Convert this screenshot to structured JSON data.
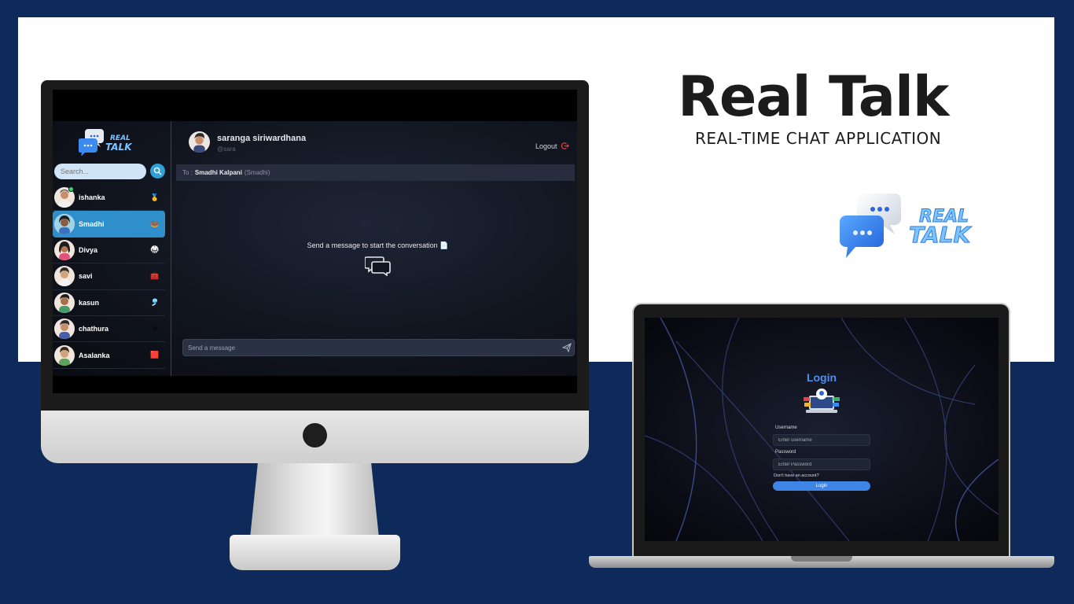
{
  "hero": {
    "title": "Real Talk",
    "subtitle": "REAL-TIME CHAT APPLICATION",
    "logo_text_line1": "REAL",
    "logo_text_line2": "TALK"
  },
  "desktop_app": {
    "sidebar": {
      "logo_line1": "REAL",
      "logo_line2": "TALK",
      "search_placeholder": "Search...",
      "contacts": [
        {
          "name": "ishanka",
          "emoji": "🥇",
          "online": true,
          "active": false
        },
        {
          "name": "Smadhi",
          "emoji": "🍩",
          "online": false,
          "active": true
        },
        {
          "name": "Divya",
          "emoji": "🥋",
          "online": false,
          "active": false
        },
        {
          "name": "savi",
          "emoji": "🧰",
          "online": false,
          "active": false
        },
        {
          "name": "kasun",
          "emoji": "🎐",
          "online": false,
          "active": false
        },
        {
          "name": "chathura",
          "emoji": "⚪",
          "online": false,
          "active": false
        },
        {
          "name": "Asalanka",
          "emoji": "🟥",
          "online": false,
          "active": false
        }
      ]
    },
    "header": {
      "user_name": "saranga siriwardhana",
      "user_handle": "@sara",
      "logout_label": "Logout"
    },
    "to_bar": {
      "prefix": "To :",
      "name": "Smadhi Kalpani",
      "handle": "(Smadhi)"
    },
    "empty_state": "Send a message to start the conversation 📄",
    "message_placeholder": "Send a message"
  },
  "laptop_app": {
    "title": "Login",
    "username_label": "Username",
    "username_placeholder": "Enter username",
    "password_label": "Password",
    "password_placeholder": "Enter Password",
    "no_account_text": "Don't have an account?",
    "login_button": "Login"
  },
  "colors": {
    "background": "#0d2a5a",
    "accent": "#2f8fcb",
    "login_accent": "#4f8ef0",
    "logout_icon": "#e0463a"
  }
}
